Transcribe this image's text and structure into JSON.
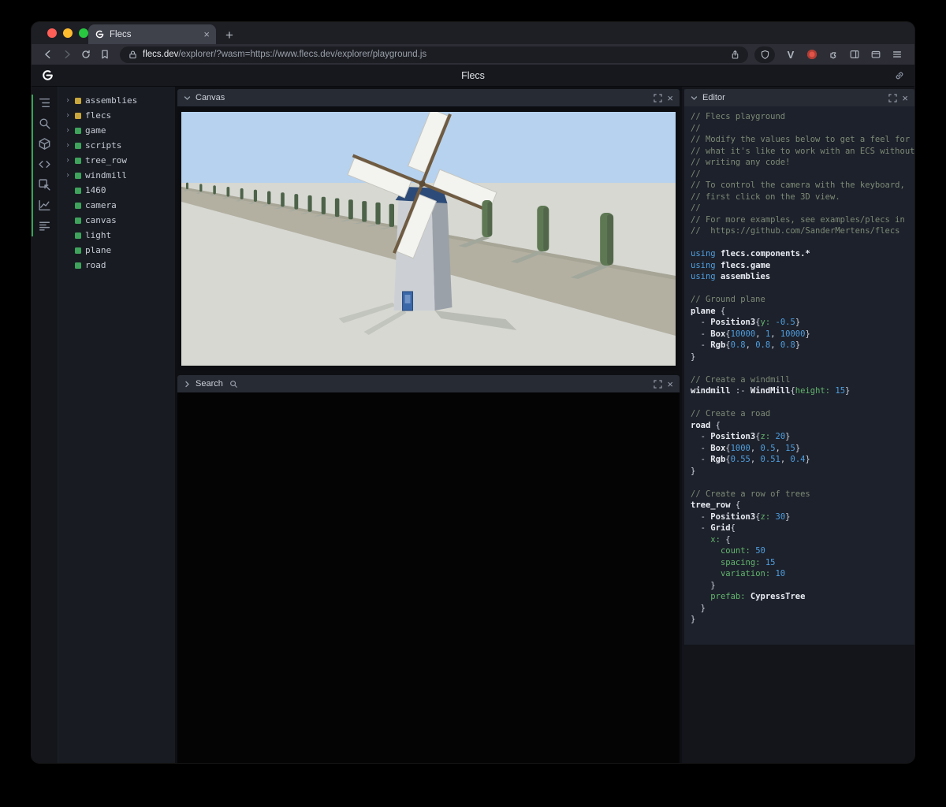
{
  "browser": {
    "traffic_lights": [
      "#ff5f57",
      "#febc2e",
      "#28c840"
    ],
    "tab_title": "Flecs",
    "new_tab_label": "+",
    "url_domain": "flecs.dev",
    "url_rest": "/explorer/?wasm=https://www.flecs.dev/explorer/playground.js"
  },
  "header": {
    "title": "Flecs"
  },
  "sidebar": {
    "icons": [
      "entity-tree-icon",
      "search-icon",
      "box-icon",
      "code-icon",
      "inspect-icon",
      "chart-icon",
      "stats-icon"
    ]
  },
  "tree": {
    "items": [
      {
        "label": "assemblies",
        "color": "#c9a73c",
        "expandable": true
      },
      {
        "label": "flecs",
        "color": "#c9a73c",
        "expandable": true
      },
      {
        "label": "game",
        "color": "#3fa35c",
        "expandable": true
      },
      {
        "label": "scripts",
        "color": "#3fa35c",
        "expandable": true
      },
      {
        "label": "tree_row",
        "color": "#3fa35c",
        "expandable": true
      },
      {
        "label": "windmill",
        "color": "#3fa35c",
        "expandable": true
      },
      {
        "label": "1460",
        "color": "#3fa35c",
        "expandable": false
      },
      {
        "label": "camera",
        "color": "#3fa35c",
        "expandable": false
      },
      {
        "label": "canvas",
        "color": "#3fa35c",
        "expandable": false
      },
      {
        "label": "light",
        "color": "#3fa35c",
        "expandable": false
      },
      {
        "label": "plane",
        "color": "#3fa35c",
        "expandable": false
      },
      {
        "label": "road",
        "color": "#3fa35c",
        "expandable": false
      }
    ]
  },
  "panels": {
    "canvas_title": "Canvas",
    "search_title": "Search",
    "editor_title": "Editor"
  },
  "colors": {
    "accent_green": "#37a35a",
    "entity_green": "#3fa35c",
    "entity_yellow": "#c9a73c",
    "keyword_blue": "#4f9fe0",
    "comment_green": "#7d8a76",
    "property_green": "#62b56e"
  },
  "code": {
    "lines": [
      [
        [
          "c",
          "// Flecs playground"
        ]
      ],
      [
        [
          "c",
          "//"
        ]
      ],
      [
        [
          "c",
          "// Modify the values below to get a feel for"
        ]
      ],
      [
        [
          "c",
          "// what it's like to work with an ECS without"
        ]
      ],
      [
        [
          "c",
          "// writing any code!"
        ]
      ],
      [
        [
          "c",
          "//"
        ]
      ],
      [
        [
          "c",
          "// To control the camera with the keyboard,"
        ]
      ],
      [
        [
          "c",
          "// first click on the 3D view."
        ]
      ],
      [
        [
          "c",
          "//"
        ]
      ],
      [
        [
          "c",
          "// For more examples, see examples/plecs in"
        ]
      ],
      [
        [
          "c",
          "//  https://github.com/SanderMertens/flecs"
        ]
      ],
      [],
      [
        [
          "k",
          "using "
        ],
        [
          "b",
          "flecs.components.*"
        ]
      ],
      [
        [
          "k",
          "using "
        ],
        [
          "b",
          "flecs.game"
        ]
      ],
      [
        [
          "k",
          "using "
        ],
        [
          "b",
          "assemblies"
        ]
      ],
      [],
      [
        [
          "c",
          "// Ground plane"
        ]
      ],
      [
        [
          "b",
          "plane"
        ],
        [
          "w",
          " {"
        ]
      ],
      [
        [
          "w",
          "  - "
        ],
        [
          "b",
          "Position3"
        ],
        [
          "w",
          "{"
        ],
        [
          "p",
          "y:"
        ],
        [
          "w",
          " "
        ],
        [
          "n",
          "-0.5"
        ],
        [
          "w",
          "}"
        ]
      ],
      [
        [
          "w",
          "  - "
        ],
        [
          "b",
          "Box"
        ],
        [
          "w",
          "{"
        ],
        [
          "n",
          "10000"
        ],
        [
          "w",
          ", "
        ],
        [
          "n",
          "1"
        ],
        [
          "w",
          ", "
        ],
        [
          "n",
          "10000"
        ],
        [
          "w",
          "}"
        ]
      ],
      [
        [
          "w",
          "  - "
        ],
        [
          "b",
          "Rgb"
        ],
        [
          "w",
          "{"
        ],
        [
          "n",
          "0.8"
        ],
        [
          "w",
          ", "
        ],
        [
          "n",
          "0.8"
        ],
        [
          "w",
          ", "
        ],
        [
          "n",
          "0.8"
        ],
        [
          "w",
          "}"
        ]
      ],
      [
        [
          "w",
          "}"
        ]
      ],
      [],
      [
        [
          "c",
          "// Create a windmill"
        ]
      ],
      [
        [
          "b",
          "windmill"
        ],
        [
          "w",
          " :- "
        ],
        [
          "b",
          "WindMill"
        ],
        [
          "w",
          "{"
        ],
        [
          "p",
          "height:"
        ],
        [
          "w",
          " "
        ],
        [
          "n",
          "15"
        ],
        [
          "w",
          "}"
        ]
      ],
      [],
      [
        [
          "c",
          "// Create a road"
        ]
      ],
      [
        [
          "b",
          "road"
        ],
        [
          "w",
          " {"
        ]
      ],
      [
        [
          "w",
          "  - "
        ],
        [
          "b",
          "Position3"
        ],
        [
          "w",
          "{"
        ],
        [
          "p",
          "z:"
        ],
        [
          "w",
          " "
        ],
        [
          "n",
          "20"
        ],
        [
          "w",
          "}"
        ]
      ],
      [
        [
          "w",
          "  - "
        ],
        [
          "b",
          "Box"
        ],
        [
          "w",
          "{"
        ],
        [
          "n",
          "1000"
        ],
        [
          "w",
          ", "
        ],
        [
          "n",
          "0.5"
        ],
        [
          "w",
          ", "
        ],
        [
          "n",
          "15"
        ],
        [
          "w",
          "}"
        ]
      ],
      [
        [
          "w",
          "  - "
        ],
        [
          "b",
          "Rgb"
        ],
        [
          "w",
          "{"
        ],
        [
          "n",
          "0.55"
        ],
        [
          "w",
          ", "
        ],
        [
          "n",
          "0.51"
        ],
        [
          "w",
          ", "
        ],
        [
          "n",
          "0.4"
        ],
        [
          "w",
          "}"
        ]
      ],
      [
        [
          "w",
          "}"
        ]
      ],
      [],
      [
        [
          "c",
          "// Create a row of trees"
        ]
      ],
      [
        [
          "b",
          "tree_row"
        ],
        [
          "w",
          " {"
        ]
      ],
      [
        [
          "w",
          "  - "
        ],
        [
          "b",
          "Position3"
        ],
        [
          "w",
          "{"
        ],
        [
          "p",
          "z:"
        ],
        [
          "w",
          " "
        ],
        [
          "n",
          "30"
        ],
        [
          "w",
          "}"
        ]
      ],
      [
        [
          "w",
          "  - "
        ],
        [
          "b",
          "Grid"
        ],
        [
          "w",
          "{"
        ]
      ],
      [
        [
          "w",
          "    "
        ],
        [
          "p",
          "x:"
        ],
        [
          "w",
          " {"
        ]
      ],
      [
        [
          "w",
          "      "
        ],
        [
          "p",
          "count:"
        ],
        [
          "w",
          " "
        ],
        [
          "n",
          "50"
        ]
      ],
      [
        [
          "w",
          "      "
        ],
        [
          "p",
          "spacing:"
        ],
        [
          "w",
          " "
        ],
        [
          "n",
          "15"
        ]
      ],
      [
        [
          "w",
          "      "
        ],
        [
          "p",
          "variation:"
        ],
        [
          "w",
          " "
        ],
        [
          "n",
          "10"
        ]
      ],
      [
        [
          "w",
          "    }"
        ]
      ],
      [
        [
          "w",
          "    "
        ],
        [
          "p",
          "prefab:"
        ],
        [
          "w",
          " "
        ],
        [
          "b",
          "CypressTree"
        ]
      ],
      [
        [
          "w",
          "  }"
        ]
      ],
      [
        [
          "w",
          "}"
        ]
      ]
    ]
  }
}
